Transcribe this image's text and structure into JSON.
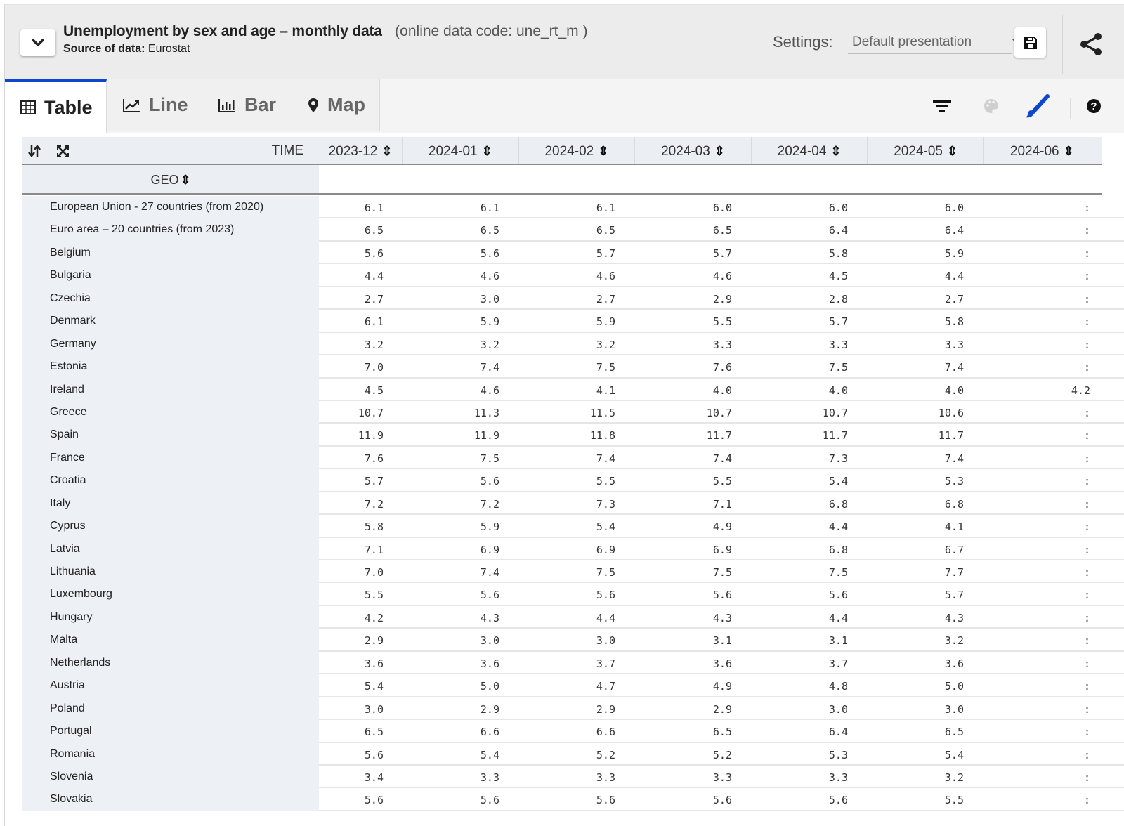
{
  "header": {
    "title": "Unemployment by sex and age – monthly data",
    "code_label": "(online data code: une_rt_m )",
    "source_label": "Source of data:",
    "source_value": "Eurostat",
    "settings_label": "Settings:",
    "settings_value": "Default presentation",
    "icons": {
      "collapse": "chevron-down-icon",
      "save": "floppy-disk-icon",
      "share": "share-icon"
    }
  },
  "tabs": [
    {
      "label": "Table",
      "icon": "table-icon",
      "active": true
    },
    {
      "label": "Line",
      "icon": "line-chart-icon",
      "active": false
    },
    {
      "label": "Bar",
      "icon": "bar-chart-icon",
      "active": false
    },
    {
      "label": "Map",
      "icon": "map-pin-icon",
      "active": false
    }
  ],
  "toolbar": {
    "icons": [
      "filter-icon",
      "palette-icon",
      "paintbrush-icon",
      "help-icon"
    ],
    "accent": "#0e47cb"
  },
  "table": {
    "corner_icons": [
      "swap-axes-icon",
      "fullscreen-icon"
    ],
    "time_label": "TIME",
    "geo_label": "GEO",
    "sort_glyph": "⇕",
    "columns": [
      "2023-12",
      "2024-01",
      "2024-02",
      "2024-03",
      "2024-04",
      "2024-05",
      "2024-06"
    ],
    "rows": [
      {
        "geo": "European Union - 27 countries (from 2020)",
        "values": [
          "6.1",
          "6.1",
          "6.1",
          "6.0",
          "6.0",
          "6.0",
          ":"
        ]
      },
      {
        "geo": "Euro area – 20 countries (from 2023)",
        "values": [
          "6.5",
          "6.5",
          "6.5",
          "6.5",
          "6.4",
          "6.4",
          ":"
        ]
      },
      {
        "geo": "Belgium",
        "values": [
          "5.6",
          "5.6",
          "5.7",
          "5.7",
          "5.8",
          "5.9",
          ":"
        ]
      },
      {
        "geo": "Bulgaria",
        "values": [
          "4.4",
          "4.6",
          "4.6",
          "4.6",
          "4.5",
          "4.4",
          ":"
        ]
      },
      {
        "geo": "Czechia",
        "values": [
          "2.7",
          "3.0",
          "2.7",
          "2.9",
          "2.8",
          "2.7",
          ":"
        ]
      },
      {
        "geo": "Denmark",
        "values": [
          "6.1",
          "5.9",
          "5.9",
          "5.5",
          "5.7",
          "5.8",
          ":"
        ]
      },
      {
        "geo": "Germany",
        "values": [
          "3.2",
          "3.2",
          "3.2",
          "3.3",
          "3.3",
          "3.3",
          ":"
        ]
      },
      {
        "geo": "Estonia",
        "values": [
          "7.0",
          "7.4",
          "7.5",
          "7.6",
          "7.5",
          "7.4",
          ":"
        ]
      },
      {
        "geo": "Ireland",
        "values": [
          "4.5",
          "4.6",
          "4.1",
          "4.0",
          "4.0",
          "4.0",
          "4.2"
        ]
      },
      {
        "geo": "Greece",
        "values": [
          "10.7",
          "11.3",
          "11.5",
          "10.7",
          "10.7",
          "10.6",
          ":"
        ]
      },
      {
        "geo": "Spain",
        "values": [
          "11.9",
          "11.9",
          "11.8",
          "11.7",
          "11.7",
          "11.7",
          ":"
        ]
      },
      {
        "geo": "France",
        "values": [
          "7.6",
          "7.5",
          "7.4",
          "7.4",
          "7.3",
          "7.4",
          ":"
        ]
      },
      {
        "geo": "Croatia",
        "values": [
          "5.7",
          "5.6",
          "5.5",
          "5.5",
          "5.4",
          "5.3",
          ":"
        ]
      },
      {
        "geo": "Italy",
        "values": [
          "7.2",
          "7.2",
          "7.3",
          "7.1",
          "6.8",
          "6.8",
          ":"
        ]
      },
      {
        "geo": "Cyprus",
        "values": [
          "5.8",
          "5.9",
          "5.4",
          "4.9",
          "4.4",
          "4.1",
          ":"
        ]
      },
      {
        "geo": "Latvia",
        "values": [
          "7.1",
          "6.9",
          "6.9",
          "6.9",
          "6.8",
          "6.7",
          ":"
        ]
      },
      {
        "geo": "Lithuania",
        "values": [
          "7.0",
          "7.4",
          "7.5",
          "7.5",
          "7.5",
          "7.7",
          ":"
        ]
      },
      {
        "geo": "Luxembourg",
        "values": [
          "5.5",
          "5.6",
          "5.6",
          "5.6",
          "5.6",
          "5.7",
          ":"
        ]
      },
      {
        "geo": "Hungary",
        "values": [
          "4.2",
          "4.3",
          "4.4",
          "4.3",
          "4.4",
          "4.3",
          ":"
        ]
      },
      {
        "geo": "Malta",
        "values": [
          "2.9",
          "3.0",
          "3.0",
          "3.1",
          "3.1",
          "3.2",
          ":"
        ]
      },
      {
        "geo": "Netherlands",
        "values": [
          "3.6",
          "3.6",
          "3.7",
          "3.6",
          "3.7",
          "3.6",
          ":"
        ]
      },
      {
        "geo": "Austria",
        "values": [
          "5.4",
          "5.0",
          "4.7",
          "4.9",
          "4.8",
          "5.0",
          ":"
        ]
      },
      {
        "geo": "Poland",
        "values": [
          "3.0",
          "2.9",
          "2.9",
          "2.9",
          "3.0",
          "3.0",
          ":"
        ]
      },
      {
        "geo": "Portugal",
        "values": [
          "6.5",
          "6.6",
          "6.6",
          "6.5",
          "6.4",
          "6.5",
          ":"
        ]
      },
      {
        "geo": "Romania",
        "values": [
          "5.6",
          "5.4",
          "5.2",
          "5.2",
          "5.3",
          "5.4",
          ":"
        ]
      },
      {
        "geo": "Slovenia",
        "values": [
          "3.4",
          "3.3",
          "3.3",
          "3.3",
          "3.3",
          "3.2",
          ":"
        ]
      },
      {
        "geo": "Slovakia",
        "values": [
          "5.6",
          "5.6",
          "5.6",
          "5.6",
          "5.6",
          "5.5",
          ":"
        ]
      }
    ]
  }
}
